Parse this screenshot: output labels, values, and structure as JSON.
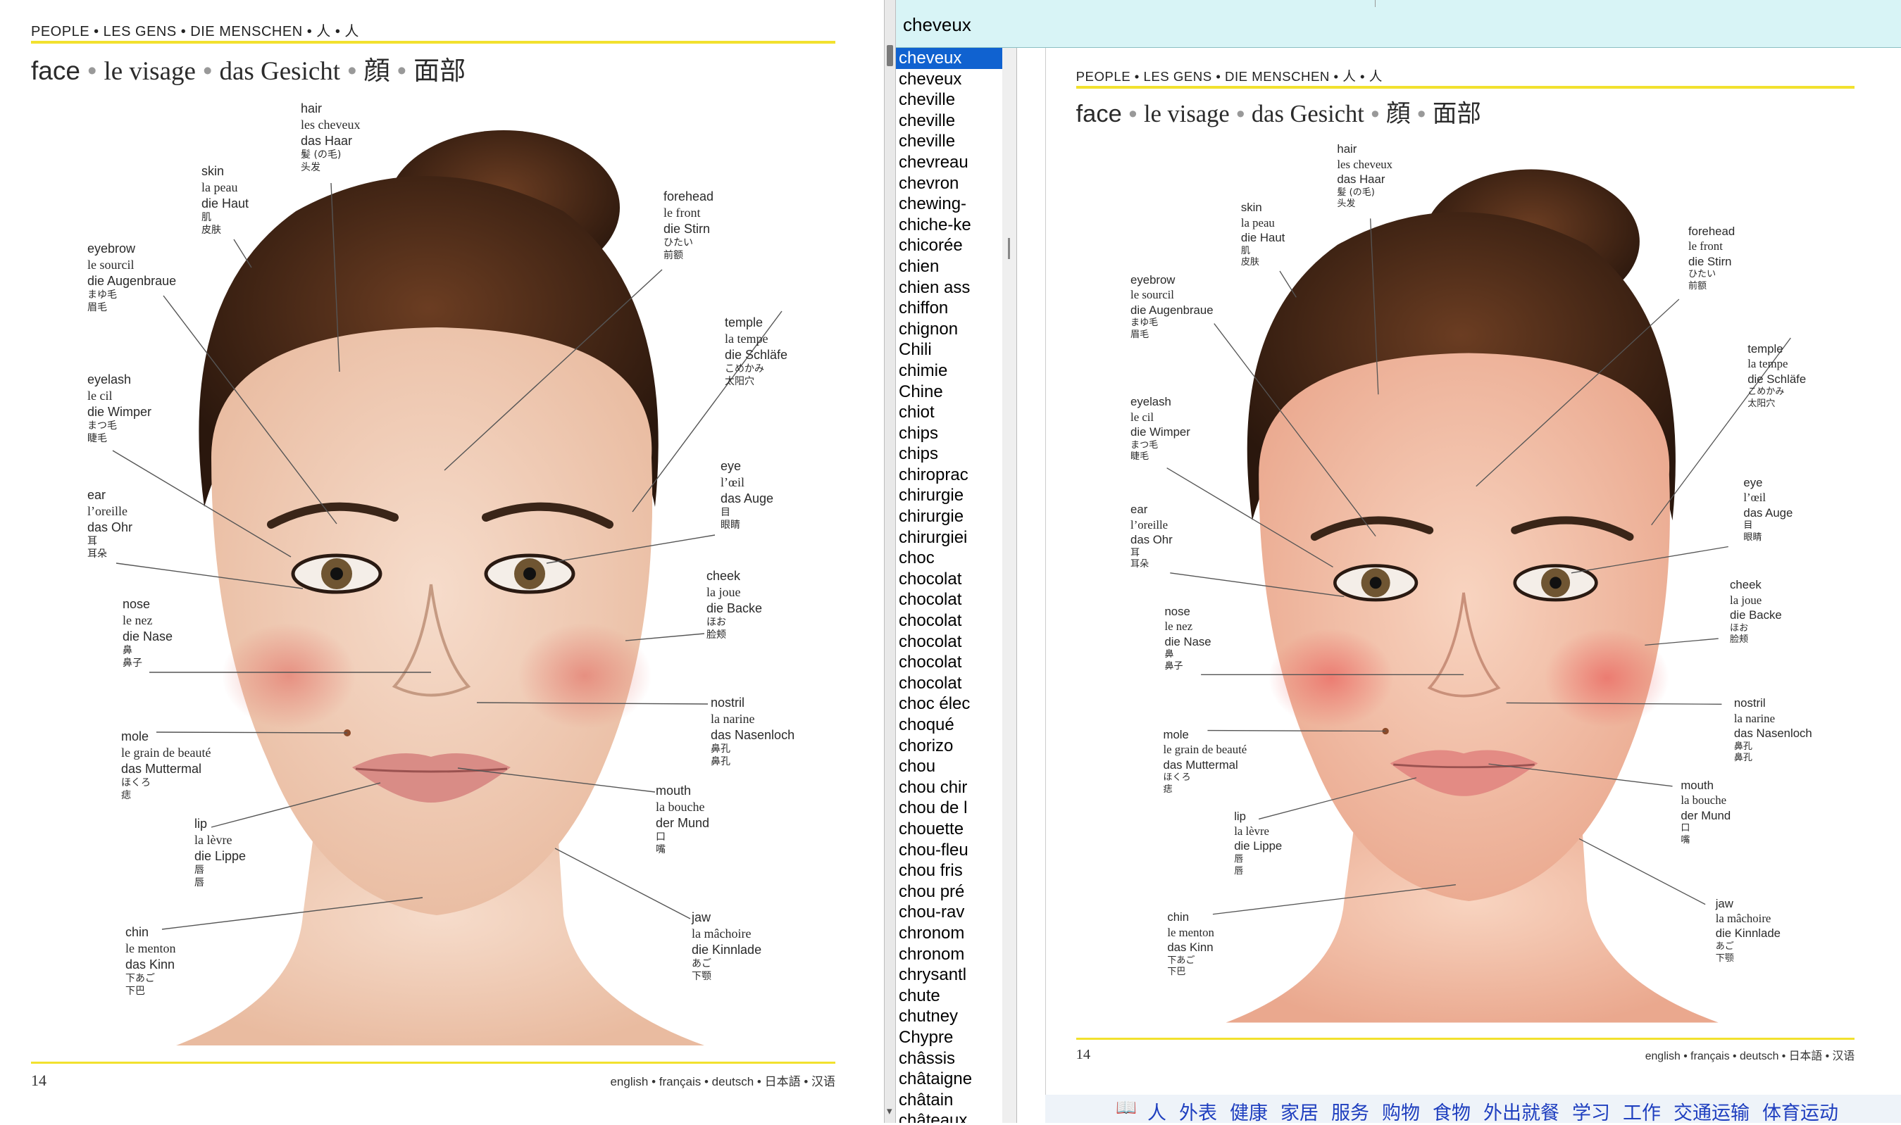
{
  "book": {
    "header": "PEOPLE • LES GENS • DIE MENSCHEN • 人 • 人",
    "title_parts": [
      "face",
      "le visage",
      "das Gesicht",
      "顔",
      "面部"
    ],
    "page_number": "14",
    "footer": "english • français • deutsch • 日本語 • 汉语",
    "labels": [
      {
        "id": "hair",
        "en": "hair",
        "fr": "les cheveux",
        "de": "das Haar",
        "jp": "髪 (の毛)",
        "zh": "头发"
      },
      {
        "id": "skin",
        "en": "skin",
        "fr": "la peau",
        "de": "die Haut",
        "jp": "肌",
        "zh": "皮肤"
      },
      {
        "id": "forehead",
        "en": "forehead",
        "fr": "le front",
        "de": "die Stirn",
        "jp": "ひたい",
        "zh": "前额"
      },
      {
        "id": "eyebrow",
        "en": "eyebrow",
        "fr": "le sourcil",
        "de": "die Augenbraue",
        "jp": "まゆ毛",
        "zh": "眉毛"
      },
      {
        "id": "temple",
        "en": "temple",
        "fr": "la tempe",
        "de": "die Schläfe",
        "jp": "こめかみ",
        "zh": "太阳穴"
      },
      {
        "id": "eyelash",
        "en": "eyelash",
        "fr": "le cil",
        "de": "die Wimper",
        "jp": "まつ毛",
        "zh": "睫毛"
      },
      {
        "id": "eye",
        "en": "eye",
        "fr": "l’œil",
        "de": "das Auge",
        "jp": "目",
        "zh": "眼睛"
      },
      {
        "id": "ear",
        "en": "ear",
        "fr": "l’oreille",
        "de": "das Ohr",
        "jp": "耳",
        "zh": "耳朵"
      },
      {
        "id": "cheek",
        "en": "cheek",
        "fr": "la joue",
        "de": "die Backe",
        "jp": "ほお",
        "zh": "脸颊"
      },
      {
        "id": "nose",
        "en": "nose",
        "fr": "le nez",
        "de": "die Nase",
        "jp": "鼻",
        "zh": "鼻子"
      },
      {
        "id": "nostril",
        "en": "nostril",
        "fr": "la narine",
        "de": "das Nasenloch",
        "jp": "鼻孔",
        "zh": "鼻孔"
      },
      {
        "id": "mole",
        "en": "mole",
        "fr": "le grain de beauté",
        "de": "das Muttermal",
        "jp": "ほくろ",
        "zh": "痣"
      },
      {
        "id": "mouth",
        "en": "mouth",
        "fr": "la bouche",
        "de": "der Mund",
        "jp": "口",
        "zh": "嘴"
      },
      {
        "id": "lip",
        "en": "lip",
        "fr": "la lèvre",
        "de": "die Lippe",
        "jp": "唇",
        "zh": "唇"
      },
      {
        "id": "jaw",
        "en": "jaw",
        "fr": "la mâchoire",
        "de": "die Kinnlade",
        "jp": "あご",
        "zh": "下颚"
      },
      {
        "id": "chin",
        "en": "chin",
        "fr": "le menton",
        "de": "das Kinn",
        "jp": "下あご",
        "zh": "下巴"
      }
    ]
  },
  "dictionary": {
    "search_value": "cheveux",
    "selected_index": 0,
    "words": [
      "cheveux",
      "cheveux",
      "cheville",
      "cheville",
      "cheville",
      "chevreau",
      "chevron",
      "chewing-",
      "chiche-ke",
      "chicorée",
      "chien",
      "chien ass",
      "chiffon",
      "chignon",
      "Chili",
      "chimie",
      "Chine",
      "chiot",
      "chips",
      "chips",
      "chiroprac",
      "chirurgie",
      "chirurgie",
      "chirurgiei",
      "choc",
      "chocolat",
      "chocolat",
      "chocolat",
      "chocolat",
      "chocolat",
      "chocolat",
      "choc élec",
      "choqué",
      "chorizo",
      "chou",
      "chou chir",
      "chou de l",
      "chouette",
      "chou-fleu",
      "chou fris",
      "chou pré",
      "chou-rav",
      "chronom",
      "chronom",
      "chrysantl",
      "chute",
      "chutney",
      "Chypre",
      "châssis",
      "châtaigne",
      "châtain",
      "châteaux"
    ],
    "toolbar": [
      "人",
      "外表",
      "健康",
      "家居",
      "服务",
      "购物",
      "食物",
      "外出就餐",
      "学习",
      "工作",
      "交通运输",
      "体育运动"
    ]
  },
  "colors": {
    "accent_yellow": "#f2e12e",
    "selection_blue": "#1062d0",
    "search_bg": "#d8f4f6",
    "toolbar_text": "#1f3fbf"
  }
}
